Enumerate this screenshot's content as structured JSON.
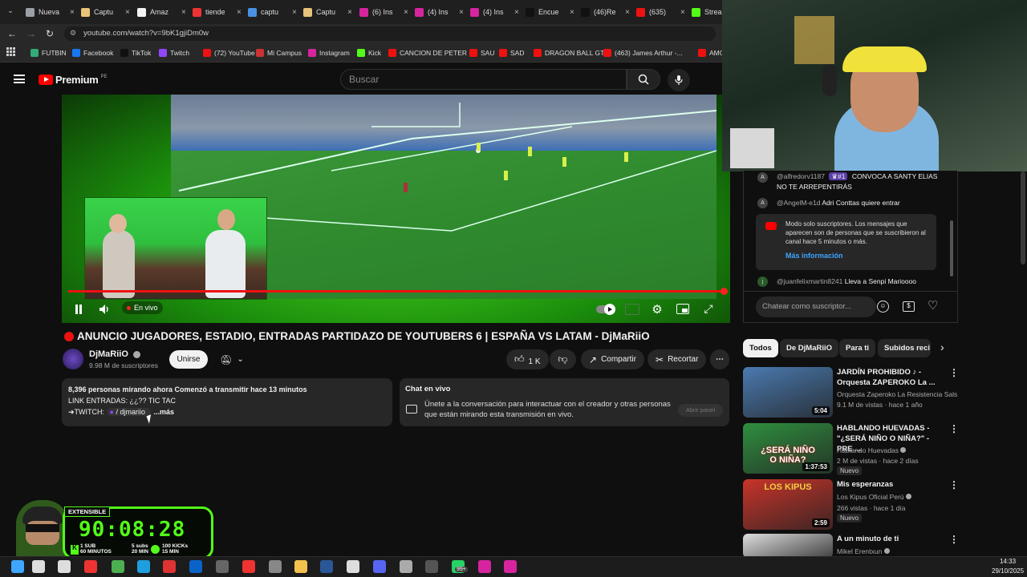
{
  "browser": {
    "tabs": [
      {
        "label": "Nueva",
        "color": "#9aa0a6"
      },
      {
        "label": "Captu",
        "color": "#e8c37a"
      },
      {
        "label": "Amaz",
        "color": "#f2f2f2"
      },
      {
        "label": "tiende",
        "color": "#e33"
      },
      {
        "label": "captu",
        "color": "#4a90e2"
      },
      {
        "label": "Captu",
        "color": "#e8c37a"
      },
      {
        "label": "(6) Ins",
        "color": "#d6249f"
      },
      {
        "label": "(4) Ins",
        "color": "#d6249f"
      },
      {
        "label": "(4) Ins",
        "color": "#d6249f"
      },
      {
        "label": "Encue",
        "color": "#111"
      },
      {
        "label": "(46)Re",
        "color": "#111"
      },
      {
        "label": "(635)",
        "color": "#e11"
      },
      {
        "label": "Strea",
        "color": "#53fc18"
      }
    ],
    "url": "youtube.com/watch?v=9bK1gjiDm0w",
    "bookmarks": [
      {
        "label": "FUTBIN",
        "color": "#3a7"
      },
      {
        "label": "Facebook",
        "color": "#1877f2"
      },
      {
        "label": "TikTok",
        "color": "#111"
      },
      {
        "label": "Twitch",
        "color": "#9146ff"
      },
      {
        "label": "(72) YouTube",
        "color": "#e11"
      },
      {
        "label": "Mi Campus",
        "color": "#c33"
      },
      {
        "label": "Instagram",
        "color": "#d6249f"
      },
      {
        "label": "Kick",
        "color": "#53fc18"
      },
      {
        "label": "CANCION DE PETER",
        "color": "#e11"
      },
      {
        "label": "SAU",
        "color": "#e11"
      },
      {
        "label": "SAD",
        "color": "#e11"
      },
      {
        "label": "DRAGON BALL GT",
        "color": "#e11"
      },
      {
        "label": "(463) James Arthur -...",
        "color": "#e11"
      },
      {
        "label": "AMOR",
        "color": "#e11"
      }
    ]
  },
  "youtube": {
    "logo": "Premium",
    "region": "PE",
    "search_placeholder": "Buscar"
  },
  "player": {
    "live_label": "En vivo",
    "progress": 1.0
  },
  "video": {
    "title": "ANUNCIO JUGADORES, ESTADIO, ENTRADAS PARTIDAZO DE YOUTUBERS 6 | ESPAÑA VS LATAM - DjMaRiiO",
    "channel": "DjMaRiiO",
    "subscribers": "9.98 M de suscriptores",
    "join_label": "Unirse",
    "likes": "1 K",
    "share_label": "Compartir",
    "clip_label": "Recortar"
  },
  "description": {
    "line1": "8,396 personas mirando ahora  Comenzó a transmitir hace 13 minutos",
    "line2": "LINK ENTRADAS: ¿¿?? TIC TAC",
    "line3_prefix": "➜TWITCH: ",
    "twitch_link": "/ djmariio",
    "more": "...más"
  },
  "live_chat_panel": {
    "title": "Chat en vivo",
    "text": "Únete a la conversación para interactuar con el creador y otras personas que están mirando esta transmisión en vivo.",
    "button": "Abrir panel"
  },
  "chat": {
    "messages": [
      {
        "avatar": "A",
        "user": "@alfredorv1187",
        "badge": "#1",
        "text": "CONVOCA A SANTY ELIAS NO TE ARREPENTIRÁS"
      },
      {
        "avatar": "A",
        "user": "@AngelM-e1d",
        "text": "Adri Conttas quiere entrar"
      },
      {
        "avatar": "j",
        "user": "@juanfelixmartin8241",
        "text": "Lleva a Senpi Marioooo"
      }
    ],
    "notice": "Modo solo suscriptores. Los mensajes que aparecen son de personas que se suscribieron al canal hace 5 minutos o más.",
    "notice_link": "Más información",
    "input_placeholder": "Chatear como suscriptor..."
  },
  "chips": [
    "Todos",
    "De DjMaRiiO",
    "Para ti",
    "Subidos reci"
  ],
  "recommendations": [
    {
      "title": "JARDÍN PROHIBIDO ♪ - Orquesta ZAPEROKO La ...",
      "channel": "Orquesta Zaperoko La Resistencia Salse...",
      "meta": "9.1 M de vistas · hace 1 año",
      "duration": "5:04",
      "badge": "",
      "thumb": "#4a7ab0"
    },
    {
      "title": "HABLANDO HUEVADAS - \"¿SERÁ NIÑO O NIÑA?\" - PRE ...",
      "channel": "Hablando Huevadas",
      "meta": "2 M de vistas · hace 2 días",
      "duration": "1:37:53",
      "badge": "Nuevo",
      "thumb": "#2f8f3f"
    },
    {
      "title": "Mis esperanzas",
      "channel": "Los Kipus Oficial Perú",
      "meta": "266 vistas · hace 1 día",
      "duration": "2:59",
      "badge": "Nuevo",
      "thumb": "#c8342a"
    },
    {
      "title": "A un minuto de ti",
      "channel": "Mikel Erentxun",
      "meta": "",
      "duration": "",
      "badge": "",
      "thumb": "#dddddd"
    }
  ],
  "thumb_text": {
    "rec2_top": "¿SERÁ NIÑO",
    "rec2_bottom": "O NIÑA?",
    "rec3": "LOS KIPUS"
  },
  "overlay": {
    "extensible": "EXTENSIBLE",
    "timer": "90:08:28",
    "sub_text": "1 SUB",
    "sub_min": "60 MINUTOS",
    "subs_text": "5 subs",
    "subs_min": "20 MIN",
    "kicks_text": "100 KICKs",
    "kicks_min": "15 MIN"
  },
  "taskbar": {
    "time": "14:33",
    "date": "29/10/2025",
    "badge": "99+"
  }
}
